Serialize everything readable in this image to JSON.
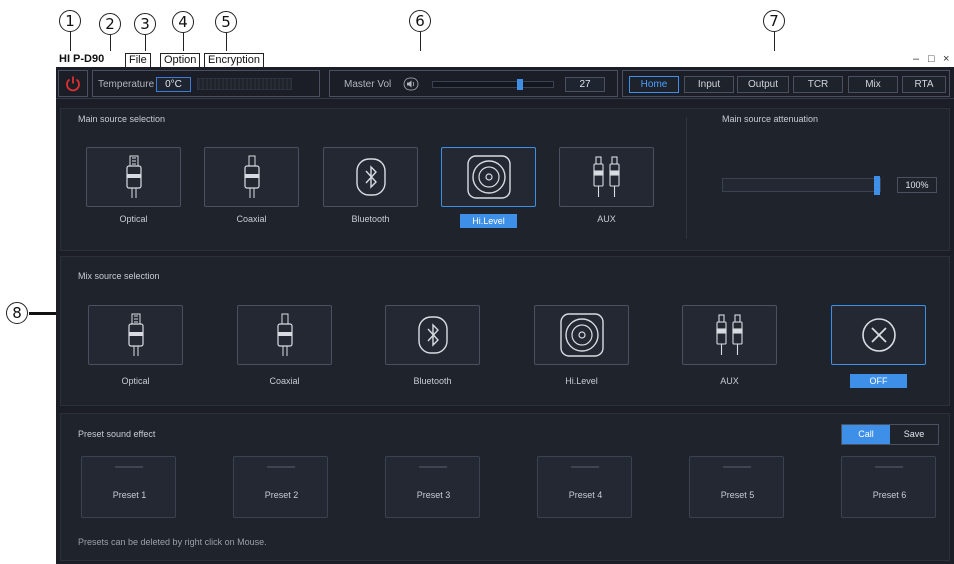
{
  "callouts": [
    "1",
    "2",
    "3",
    "4",
    "5",
    "6",
    "7",
    "8"
  ],
  "window": {
    "title": "HI P-D90",
    "menu": [
      "File",
      "Option",
      "Encryption"
    ],
    "controls": {
      "minimize": "–",
      "maximize": "□",
      "close": "×"
    }
  },
  "toolbar": {
    "power_icon": "power-icon",
    "temperature_label": "Temperature",
    "temperature_value": "0°C",
    "master_vol_label": "Master Vol",
    "master_vol_value": "27",
    "master_vol_level_pct": 74,
    "nav": [
      "Home",
      "Input",
      "Output",
      "TCR",
      "Mix",
      "RTA"
    ],
    "nav_active": "Home"
  },
  "main_source": {
    "title": "Main source selection",
    "items": [
      "Optical",
      "Coaxial",
      "Bluetooth",
      "Hi.Level",
      "AUX"
    ],
    "selected": "Hi.Level"
  },
  "attenuation": {
    "title": "Main source attenuation",
    "value": "100%",
    "level_pct": 100
  },
  "mix_source": {
    "title": "Mix  source selection",
    "items": [
      "Optical",
      "Coaxial",
      "Bluetooth",
      "Hi.Level",
      "AUX",
      "OFF"
    ],
    "selected": "OFF"
  },
  "presets": {
    "title": "Preset sound effect",
    "call_label": "Call",
    "save_label": "Save",
    "items": [
      "Preset 1",
      "Preset 2",
      "Preset 3",
      "Preset 4",
      "Preset 5",
      "Preset 6"
    ],
    "hint": "Presets can be deleted by right click on Mouse."
  },
  "colors": {
    "accent": "#3d8fe8",
    "power": "#e03030",
    "background": "#1b1e26"
  }
}
